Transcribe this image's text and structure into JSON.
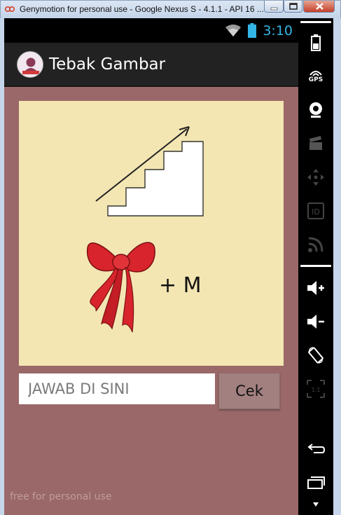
{
  "window": {
    "title": "Genymotion for personal use - Google Nexus S - 4.1.1 - API 16 ..."
  },
  "statusbar": {
    "time": "3:10"
  },
  "actionbar": {
    "title": "Tebak Gambar",
    "logo_text": "TEBAK GAMBAR"
  },
  "puzzle": {
    "plus_letter": "+ M"
  },
  "answer": {
    "placeholder": "JAWAB DI SINI",
    "value": ""
  },
  "buttons": {
    "check_label": "Cek"
  },
  "watermark": "free for personal use",
  "sidebar": {
    "gps_label": "GPS",
    "id_label": "ID",
    "ratio_label": "1:1"
  },
  "colors": {
    "content_bg": "#9a6868",
    "puzzle_bg": "#f3e6b3",
    "time_color": "#33b5e5",
    "actionbar_bg": "#222222"
  }
}
